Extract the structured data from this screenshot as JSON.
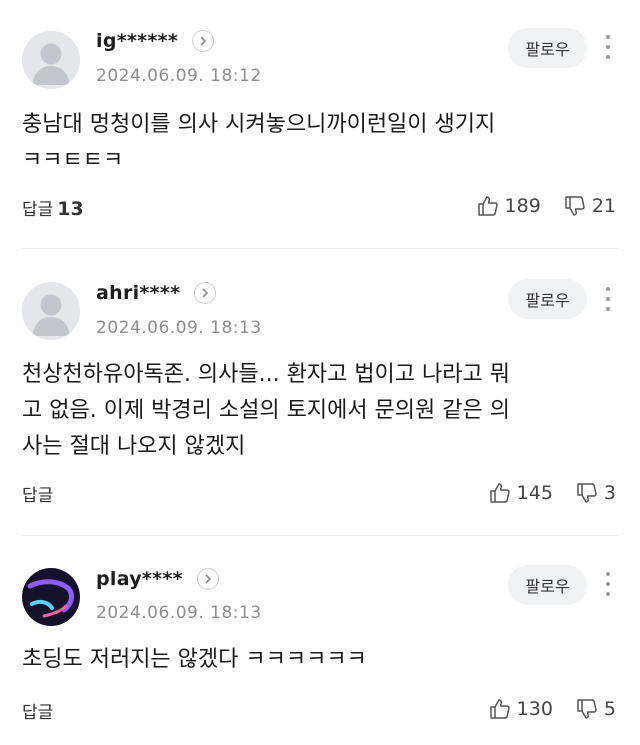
{
  "follow_label": "팔로우",
  "reply_label": "답글",
  "comments": [
    {
      "username": "ig******",
      "date": "2024.06.09. 18:12",
      "text": "충남대 멍청이를 의사 시켜놓으니까이런일이 생기지\nㅋㅋㅌㅌㅋ",
      "reply_count": "13",
      "likes": "189",
      "dislikes": "21",
      "avatar": "default-person-avatar"
    },
    {
      "username": "ahri****",
      "date": "2024.06.09. 18:13",
      "text": "천상천하유아독존. 의사들... 환자고 법이고 나라고 뭐\n고 없음. 이제 박경리 소설의 토지에서 문의원 같은 의\n사는 절대 나오지 않겠지",
      "reply_count": "",
      "likes": "145",
      "dislikes": "3",
      "avatar": "default-person-avatar"
    },
    {
      "username": "play****",
      "date": "2024.06.09. 18:13",
      "text": "초딩도 저러지는 않겠다 ㅋㅋㅋㅋㅋㅋ",
      "reply_count": "",
      "likes": "130",
      "dislikes": "5",
      "avatar": "dark-abstract-avatar"
    }
  ],
  "colors": {
    "background": "#ffffff",
    "follow_bg": "#f1f2f4",
    "date_text": "#8e8e8e",
    "divider": "#ececec"
  }
}
